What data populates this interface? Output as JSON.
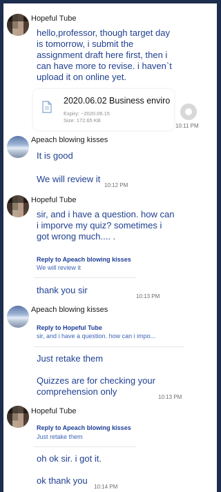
{
  "messages": [
    {
      "sender": "Hopeful Tube",
      "text": "hello,professor, though target day\nis tomorrow, i submit the\nassignment draft here first, then i\ncan have more to revise. i haven`t\nupload it on online yet.",
      "file": {
        "name": "2020.06.02 Business enviro",
        "expiry": "Expiry: ~2020.06.15",
        "size": "Size: 172.65 KB"
      },
      "time": "10:11 PM"
    },
    {
      "sender": "Apeach blowing kisses",
      "lines": [
        "It is good",
        "We will review it"
      ],
      "time": "10:12 PM"
    },
    {
      "sender": "Hopeful Tube",
      "text": "sir, and i have a question. how can\ni imporve my quiz? sometimes i\ngot wrong much.... .",
      "reply": {
        "title": "Reply to Apeach blowing kisses",
        "body": "We will review it"
      },
      "followup": "thank you sir",
      "time": "10:13 PM"
    },
    {
      "sender": "Apeach blowing kisses",
      "reply": {
        "title": "Reply to Hopeful Tube",
        "body": "sir, and i have a question. how can i impo..."
      },
      "lines": [
        "Just retake them",
        "Quizzes are for checking your\ncomprehension only"
      ],
      "time": "10:13 PM"
    },
    {
      "sender": "Hopeful Tube",
      "reply": {
        "title": "Reply to Apeach blowing kisses",
        "body": "Just retake them"
      },
      "lines": [
        "oh ok sir. i got it.",
        "ok thank you"
      ],
      "time": "10:14 PM"
    }
  ],
  "icons": {
    "file": "document-icon",
    "share": "share-icon"
  },
  "colors": {
    "message_text": "#1f3f8f",
    "reply_title": "#1e3e96",
    "frame": "#1d2d4d"
  }
}
